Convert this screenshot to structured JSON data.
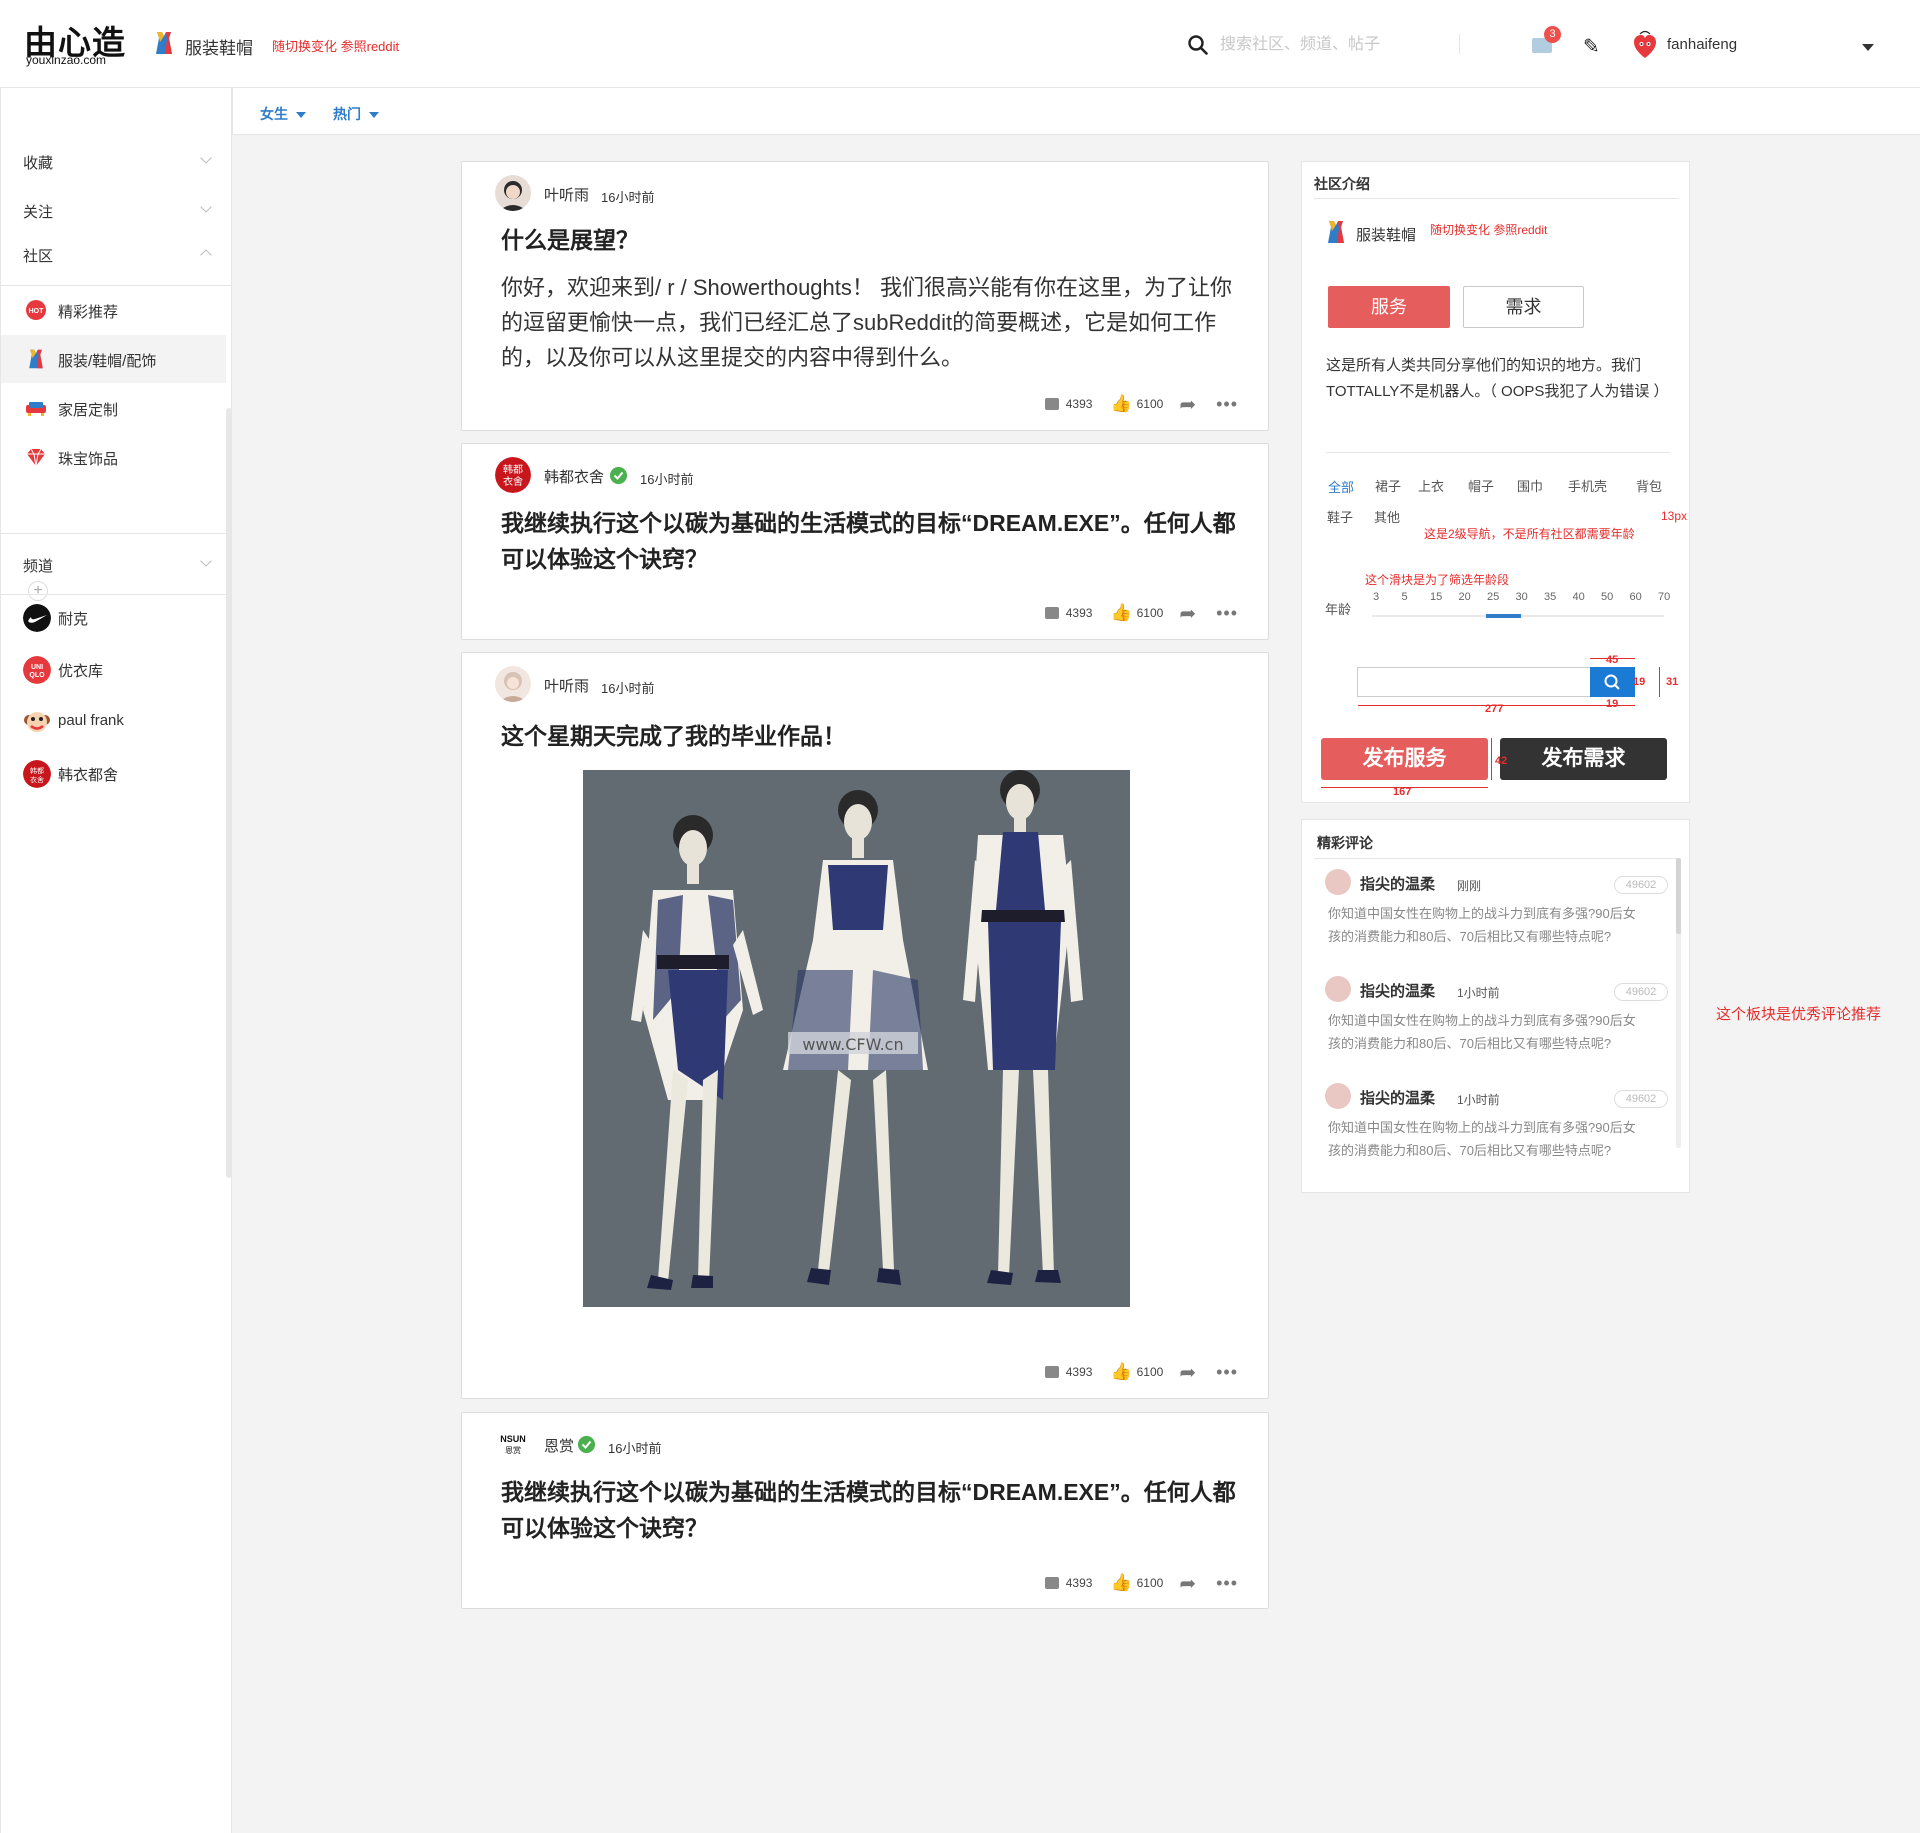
{
  "header": {
    "logo_text": "由心造",
    "logo_sub": "youxinzao.com",
    "category": "服装鞋帽",
    "category_note": "随切换变化 参照reddit",
    "search_placeholder": "搜索社区、频道、帖子",
    "mail_badge": "3",
    "username": "fanhaifeng"
  },
  "subnav": {
    "items": [
      "女生",
      "热门"
    ]
  },
  "sidebar": {
    "groups": [
      "收藏",
      "关注",
      "社区",
      "频道"
    ],
    "community_items": [
      {
        "label": "精彩推荐",
        "icon": "hot-icon"
      },
      {
        "label": "服装/鞋帽/配饰",
        "icon": "clothing-icon"
      },
      {
        "label": "家居定制",
        "icon": "sofa-icon"
      },
      {
        "label": "珠宝饰品",
        "icon": "diamond-icon"
      }
    ],
    "plus": "+",
    "channel_items": [
      {
        "label": "耐克",
        "icon": "nike-logo"
      },
      {
        "label": "优衣库",
        "icon": "uniqlo-logo"
      },
      {
        "label": "paul frank",
        "icon": "paulfrank-logo"
      },
      {
        "label": "韩衣都舍",
        "icon": "handu-logo"
      }
    ]
  },
  "posts": [
    {
      "author": "叶听雨",
      "time": "16小时前",
      "title": "什么是展望？",
      "body": "你好，欢迎来到/ r / Showerthoughts！ 我们很高兴能有你在这里，为了让你的逗留更愉快一点，我们已经汇总了subReddit的简要概述，它是如何工作的，以及你可以从这里提交的内容中得到什么。",
      "comments": "4393",
      "likes": "6100"
    },
    {
      "author": "韩都衣舍",
      "time": "16小时前",
      "title": "我继续执行这个以碳为基础的生活模式的目标“DREAM.EXE”。任何人都可以体验这个诀窍？",
      "comments": "4393",
      "likes": "6100",
      "avatar_text": "韩都衣舍"
    },
    {
      "author": "叶听雨",
      "time": "16小时前",
      "title": "这个星期天完成了我的毕业作品！",
      "image_watermark": "www.CFW.cn",
      "comments": "4393",
      "likes": "6100"
    },
    {
      "author": "恩赏",
      "time": "16小时前",
      "title": "我继续执行这个以碳为基础的生活模式的目标“DREAM.EXE”。任何人都可以体验这个诀窍？",
      "comments": "4393",
      "likes": "6100",
      "avatar_text": "NSUN 恩赏"
    }
  ],
  "community_panel": {
    "title": "社区介绍",
    "category": "服装鞋帽",
    "category_note": "随切换变化 参照reddit",
    "btn_service": "服务",
    "btn_demand": "需求",
    "description": "这是所有人类共同分享他们的知识的地方。我们TOTTALLY不是机器人。（ OOPS我犯了人为错误 ）",
    "tags_row1": [
      "全部",
      "裙子",
      "上衣",
      "帽子",
      "围巾",
      "手机壳",
      "背包"
    ],
    "tags_row2": [
      "鞋子",
      "其他"
    ],
    "note_13px": "13px",
    "note_nav": "这是2级导航，不是所有社区都需要年龄",
    "note_slider": "这个滑块是为了筛选年龄段",
    "age_label": "年龄",
    "age_ticks": [
      "3",
      "5",
      "15",
      "20",
      "25",
      "30",
      "35",
      "40",
      "50",
      "60",
      "70"
    ],
    "age_range_selected": [
      25,
      30
    ],
    "dim_45": "45",
    "dim_19a": "19",
    "dim_31": "31",
    "dim_277": "277",
    "dim_19b": "19",
    "dim_42": "42",
    "dim_167": "167",
    "btn_pub_service": "发布服务",
    "btn_pub_demand": "发布需求"
  },
  "comments_panel": {
    "title": "精彩评论",
    "side_note": "这个板块是优秀评论推荐",
    "items": [
      {
        "name": "指尖的温柔",
        "time": "刚刚",
        "count": "49602",
        "text": "你知道中国女性在购物上的战斗力到底有多强?90后女孩的消费能力和80后、70后相比又有哪些特点呢?"
      },
      {
        "name": "指尖的温柔",
        "time": "1小时前",
        "count": "49602",
        "text": "你知道中国女性在购物上的战斗力到底有多强?90后女孩的消费能力和80后、70后相比又有哪些特点呢?"
      },
      {
        "name": "指尖的温柔",
        "time": "1小时前",
        "count": "49602",
        "text": "你知道中国女性在购物上的战斗力到底有多强?90后女孩的消费能力和80后、70后相比又有哪些特点呢?"
      }
    ]
  },
  "colors": {
    "accent_blue": "#2f7dc9",
    "service_red": "#e55e5d",
    "note_red": "#e62d2d",
    "demand_dark": "#333333"
  }
}
